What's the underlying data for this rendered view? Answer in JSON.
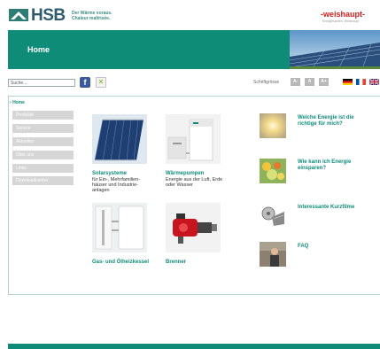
{
  "header": {
    "logo_text": "HSB",
    "tagline_1": "Der Wärme voraus.",
    "tagline_2": "Chaleur maîtrisée.",
    "partner_logo": "-weishaupt-",
    "partner_sub": "Energiesparen. Weishaupt"
  },
  "banner": {
    "title": "Home"
  },
  "toolbar": {
    "search_value": "Suche...",
    "facebook_label": "f",
    "font_size_label": "Schriftgrösse",
    "font_sizes": [
      "A-",
      "A",
      "A+"
    ]
  },
  "sidebar": {
    "active": "Home",
    "items": [
      {
        "label": "Produkte"
      },
      {
        "label": "Service"
      },
      {
        "label": "Aktuelles"
      },
      {
        "label": "Über uns"
      },
      {
        "label": "Links"
      },
      {
        "label": "Downloadcenter"
      }
    ]
  },
  "tiles": [
    {
      "title": "Solarsysteme",
      "desc": "für Ein-, Mehrfamilien-häuser und Industrie-anlagen"
    },
    {
      "title": "Wärmepumpen",
      "desc": "Energie aus der Luft, Erde oder Wasser"
    },
    {
      "title": "Gas- und Ölheizkessel",
      "desc": ""
    },
    {
      "title": "Brenner",
      "desc": ""
    }
  ],
  "right_links": [
    {
      "label": "Welche Energie ist die richtige für mich?"
    },
    {
      "label": "Wie kann ich Energie einsparen?"
    },
    {
      "label": "Interessante Kurzfilme"
    },
    {
      "label": "FAQ"
    }
  ],
  "colors": {
    "accent": "#0f8c78",
    "brand_red": "#d21e1e",
    "nav_gray": "#d6d6d6"
  }
}
